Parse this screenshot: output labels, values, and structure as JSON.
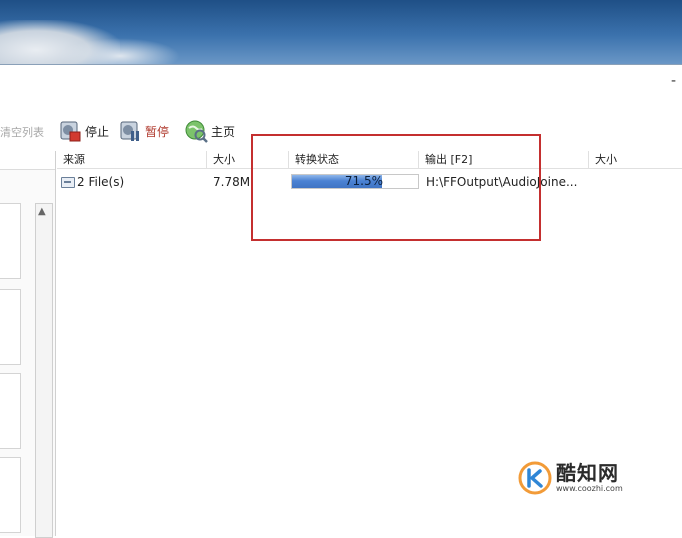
{
  "window": {
    "minimize_label": "-"
  },
  "toolbar": {
    "clear_label": "清空列表",
    "stop_label": "停止",
    "pause_label": "暂停",
    "home_label": "主页"
  },
  "list": {
    "columns": [
      "来源",
      "大小",
      "转换状态",
      "输出 [F2]",
      "大小"
    ],
    "rows": [
      {
        "source": "2 File(s)",
        "size": "7.78M",
        "status_percent_label": "71.5%",
        "status_progress": 0.715,
        "output": "H:\\FFOutput\\AudioJoine..."
      }
    ]
  },
  "watermark": {
    "title": "酷知网",
    "url": "www.coozhi.com"
  },
  "colors": {
    "progress_fill": "#4b82d3",
    "highlight_border": "#c42f2f",
    "pause_text": "#b03a2e"
  }
}
